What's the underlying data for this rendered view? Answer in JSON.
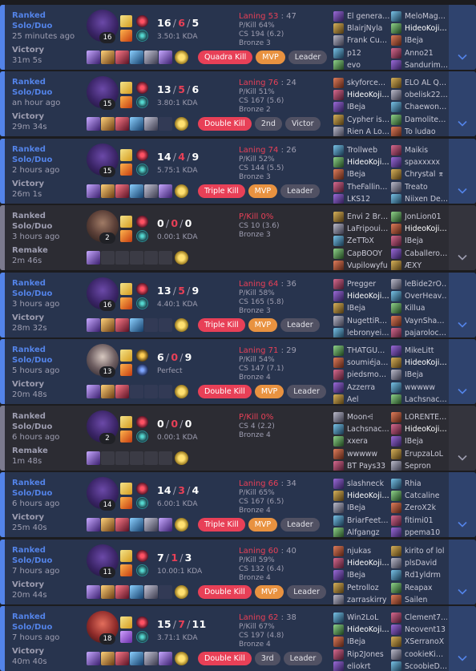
{
  "matches": [
    {
      "queue": "Ranked Solo/Duo",
      "ago": "25 minutes ago",
      "result": "Victory",
      "duration": "31m 5s",
      "type": "victory",
      "champ": "vex",
      "level": "16",
      "k": "16",
      "d": "6",
      "a": "5",
      "ratio": "3.50:1 KDA",
      "laning": "Laning 53",
      "laning_opp": "47",
      "pkill": "P/Kill 64%",
      "cs": "CS 194 (6.2)",
      "rank": "Bronze 3",
      "items": [
        1,
        1,
        1,
        1,
        1,
        1
      ],
      "badges": [
        {
          "t": "Quadra Kill",
          "c": "mk"
        },
        {
          "t": "MVP",
          "c": "mvp"
        },
        {
          "t": "Leader",
          "c": "rk"
        }
      ],
      "blue": [
        "El genera…",
        "BlairjNyla",
        "Frank Cu…",
        "p12",
        "evo"
      ],
      "red": [
        "MeloMag…",
        "HideoKoji…",
        "IBeja",
        "Anno21",
        "Sandurim…"
      ],
      "me_team": "red",
      "me_idx": 1
    },
    {
      "queue": "Ranked Solo/Duo",
      "ago": "an hour ago",
      "result": "Victory",
      "duration": "29m 34s",
      "type": "victory",
      "champ": "vex",
      "level": "15",
      "k": "13",
      "d": "5",
      "a": "6",
      "ratio": "3.80:1 KDA",
      "laning": "Laning 76",
      "laning_opp": "24",
      "pkill": "P/Kill 51%",
      "cs": "CS 167 (5.6)",
      "rank": "Bronze 2",
      "items": [
        1,
        1,
        1,
        1,
        1,
        0
      ],
      "badges": [
        {
          "t": "Double Kill",
          "c": "mk"
        },
        {
          "t": "2nd",
          "c": "rk"
        },
        {
          "t": "Victor",
          "c": "rk"
        }
      ],
      "blue": [
        "skyforce…",
        "HideoKoji…",
        "IBeja",
        "Cypher is…",
        "Rien A Lo…"
      ],
      "red": [
        "ELO AL Q…",
        "obelisk22…",
        "Chaewon…",
        "Damolite…",
        "To ludao"
      ],
      "me_team": "blue",
      "me_idx": 1
    },
    {
      "queue": "Ranked Solo/Duo",
      "ago": "2 hours ago",
      "result": "Victory",
      "duration": "26m 1s",
      "type": "victory",
      "champ": "vex",
      "level": "15",
      "k": "14",
      "d": "4",
      "a": "9",
      "ratio": "5.75:1 KDA",
      "laning": "Laning 74",
      "laning_opp": "26",
      "pkill": "P/Kill 52%",
      "cs": "CS 144 (5.5)",
      "rank": "Bronze 3",
      "items": [
        1,
        1,
        1,
        1,
        1,
        1
      ],
      "badges": [
        {
          "t": "Triple Kill",
          "c": "mk"
        },
        {
          "t": "MVP",
          "c": "mvp"
        },
        {
          "t": "Leader",
          "c": "rk"
        }
      ],
      "blue": [
        "Trollweb",
        "HideoKoji…",
        "IBeja",
        "TheFallin…",
        "LKS12"
      ],
      "red": [
        "Maikis",
        "spaxxxxx",
        "Chrystal ⌆",
        "Treato",
        "Niixen De…"
      ],
      "me_team": "blue",
      "me_idx": 1
    },
    {
      "queue": "Ranked Solo/Duo",
      "ago": "3 hours ago",
      "result": "Remake",
      "duration": "2m 46s",
      "type": "remake",
      "champ": "eko",
      "level": "2",
      "k": "0",
      "d": "0",
      "a": "0",
      "ratio": "0.00:1 KDA",
      "laning": "",
      "laning_opp": "",
      "pkill": "P/Kill 0%",
      "cs": "CS 10 (3.6)",
      "rank": "Bronze 3",
      "items": [
        1,
        0,
        0,
        0,
        0,
        0
      ],
      "badges": [],
      "blue": [
        "Envi 2 Br…",
        "LaFripoui…",
        "ZeTToX",
        "CapBOOY",
        "Vupilowyfu"
      ],
      "red": [
        "JonLion01",
        "HideoKoji…",
        "IBeja",
        "Caballero…",
        "ÆXY"
      ],
      "me_team": "red",
      "me_idx": 1
    },
    {
      "queue": "Ranked Solo/Duo",
      "ago": "3 hours ago",
      "result": "Victory",
      "duration": "28m 32s",
      "type": "victory",
      "champ": "vex",
      "level": "16",
      "k": "13",
      "d": "5",
      "a": "9",
      "ratio": "4.40:1 KDA",
      "laning": "Laning 64",
      "laning_opp": "36",
      "pkill": "P/Kill 58%",
      "cs": "CS 165 (5.8)",
      "rank": "Bronze 3",
      "items": [
        1,
        1,
        1,
        1,
        0,
        0
      ],
      "badges": [
        {
          "t": "Triple Kill",
          "c": "mk"
        },
        {
          "t": "MVP",
          "c": "mvp"
        },
        {
          "t": "Leader",
          "c": "rk"
        }
      ],
      "blue": [
        "Pregger",
        "HideoKoji…",
        "IBeja",
        "NugettiR…",
        "lebronyei…"
      ],
      "red": [
        "leBide2rO…",
        "OverHeav…",
        "Killua",
        "VaynSha…",
        "pajaroloc…"
      ],
      "me_team": "blue",
      "me_idx": 1
    },
    {
      "queue": "Ranked Solo/Duo",
      "ago": "5 hours ago",
      "result": "Victory",
      "duration": "20m 48s",
      "type": "victory",
      "champ": "zed",
      "level": "13",
      "k": "6",
      "d": "0",
      "a": "9",
      "ratio": "Perfect",
      "laning": "Laning 71",
      "laning_opp": "29",
      "pkill": "P/Kill 54%",
      "cs": "CS 147 (7.1)",
      "rank": "Bronze 4",
      "items": [
        1,
        1,
        1,
        0,
        0,
        0
      ],
      "badges": [
        {
          "t": "Double Kill",
          "c": "mk"
        },
        {
          "t": "MVP",
          "c": "mvp"
        },
        {
          "t": "Leader",
          "c": "rk"
        }
      ],
      "blue": [
        "THATGU…",
        "soumiéja…",
        "piedsmo…",
        "Azzerra",
        "Ael"
      ],
      "red": [
        "MikeLitt",
        "HideoKoji…",
        "IBeja",
        "wwwww",
        "Lachsnac…"
      ],
      "me_team": "red",
      "me_idx": 1
    },
    {
      "queue": "Ranked Solo/Duo",
      "ago": "6 hours ago",
      "result": "Remake",
      "duration": "1m 48s",
      "type": "remake",
      "champ": "vex",
      "level": "2",
      "k": "0",
      "d": "0",
      "a": "0",
      "ratio": "0.00:1 KDA",
      "laning": "",
      "laning_opp": "",
      "pkill": "P/Kill 0%",
      "cs": "CS 4 (2.2)",
      "rank": "Bronze 4",
      "items": [
        1,
        0,
        0,
        0,
        0,
        0
      ],
      "badges": [],
      "blue": [
        "Moon⩤",
        "Lachsnac…",
        "xxera",
        "wwwww",
        "BT Pays33"
      ],
      "red": [
        "LORENTE…",
        "HideoKoji…",
        "IBeja",
        "ErupzaLoL",
        "Sepron"
      ],
      "me_team": "red",
      "me_idx": 1
    },
    {
      "queue": "Ranked Solo/Duo",
      "ago": "6 hours ago",
      "result": "Victory",
      "duration": "25m 40s",
      "type": "victory",
      "champ": "vex",
      "level": "14",
      "k": "14",
      "d": "3",
      "a": "4",
      "ratio": "6.00:1 KDA",
      "laning": "Laning 66",
      "laning_opp": "34",
      "pkill": "P/Kill 65%",
      "cs": "CS 167 (6.5)",
      "rank": "Bronze 4",
      "items": [
        1,
        1,
        1,
        1,
        1,
        1
      ],
      "badges": [
        {
          "t": "Triple Kill",
          "c": "mk"
        },
        {
          "t": "MVP",
          "c": "mvp"
        },
        {
          "t": "Leader",
          "c": "rk"
        }
      ],
      "blue": [
        "slashneck",
        "HideoKoji…",
        "IBeja",
        "BriarFeet…",
        "Alfgangz"
      ],
      "red": [
        "Rhia",
        "Catcaline",
        "ZeroX2k",
        "fitimi01",
        "ppema10"
      ],
      "me_team": "blue",
      "me_idx": 1
    },
    {
      "queue": "Ranked Solo/Duo",
      "ago": "7 hours ago",
      "result": "Victory",
      "duration": "20m 44s",
      "type": "victory",
      "champ": "vex",
      "level": "11",
      "k": "7",
      "d": "1",
      "a": "3",
      "ratio": "10.00:1 KDA",
      "laning": "Laning 60",
      "laning_opp": "40",
      "pkill": "P/Kill 59%",
      "cs": "CS 132 (6.4)",
      "rank": "Bronze 4",
      "items": [
        1,
        1,
        1,
        1,
        1,
        0
      ],
      "badges": [
        {
          "t": "Double Kill",
          "c": "mk"
        },
        {
          "t": "MVP",
          "c": "mvp"
        },
        {
          "t": "Leader",
          "c": "rk"
        }
      ],
      "blue": [
        "njukas",
        "HideoKoji…",
        "IBeja",
        "Petrolloz",
        "zarraskirry"
      ],
      "red": [
        "kirito of lol",
        "plsDavid",
        "Rd1yldrm",
        "Reapax",
        "Sailen"
      ],
      "me_team": "blue",
      "me_idx": 1
    },
    {
      "queue": "Ranked Solo/Duo",
      "ago": "7 hours ago",
      "result": "Victory",
      "duration": "40m 40s",
      "type": "victory",
      "champ": "akali",
      "level": "18",
      "k": "15",
      "d": "7",
      "a": "11",
      "ratio": "3.71:1 KDA",
      "laning": "Laning 62",
      "laning_opp": "38",
      "pkill": "P/Kill 67%",
      "cs": "CS 197 (4.8)",
      "rank": "Bronze 4",
      "items": [
        1,
        1,
        1,
        1,
        1,
        1
      ],
      "badges": [
        {
          "t": "Double Kill",
          "c": "mk"
        },
        {
          "t": "3rd",
          "c": "rk"
        },
        {
          "t": "Leader",
          "c": "rk"
        }
      ],
      "blue": [
        "Win2LoL",
        "HideoKoji…",
        "IBeja",
        "Rip2Jones",
        "eliokrt"
      ],
      "red": [
        "Clement7…",
        "Neovent13",
        "XSerranoX",
        "cookieKi…",
        "ScoobieD…"
      ],
      "me_team": "blue",
      "me_idx": 1
    }
  ]
}
